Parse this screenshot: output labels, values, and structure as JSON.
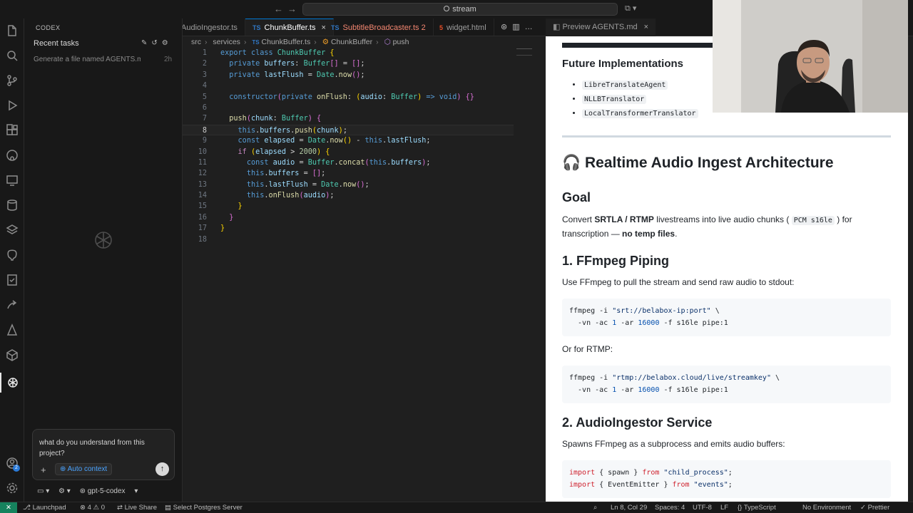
{
  "titlebar": {
    "search": "stream"
  },
  "sidebar": {
    "header": "CODEX",
    "recent_title": "Recent tasks",
    "task": "Generate a file named AGENTS.md t...",
    "task_time": "2h",
    "chat_placeholder": "what do you understand from this project?",
    "auto_context": "Auto context",
    "model": "gpt-5-codex"
  },
  "activity": {
    "badge": "2"
  },
  "editor": {
    "tabs": [
      {
        "label": "AudioIngestor.ts",
        "modified": ""
      },
      {
        "label": "ChunkBuffer.ts",
        "modified": ""
      },
      {
        "label": "SubtitleBroadcaster.ts",
        "modified": "2"
      },
      {
        "label": "widget.html",
        "modified": ""
      }
    ],
    "breadcrumb": [
      "src",
      "services",
      "ChunkBuffer.ts",
      "ChunkBuffer",
      "push"
    ],
    "line_numbers": [
      "1",
      "2",
      "3",
      "4",
      "5",
      "6",
      "7",
      "8",
      "9",
      "10",
      "11",
      "12",
      "13",
      "14",
      "15",
      "16",
      "17",
      "18"
    ],
    "current_line": "8"
  },
  "preview": {
    "tab": "Preview AGENTS.md",
    "future_title": "Future Implementations",
    "future_items": [
      "LibreTranslateAgent",
      "NLLBTranslator",
      "LocalTransformerTranslator"
    ],
    "main_title": "🎧 Realtime Audio Ingest Architecture",
    "goal_title": "Goal",
    "goal_text_1": "Convert",
    "goal_bold": "SRTLA / RTMP",
    "goal_text_2": "livestreams into live audio chunks (",
    "goal_code": "PCM s16le",
    "goal_text_3": ") for transcription —",
    "goal_bold_2": "no temp files",
    "s1_title": "1. FFmpeg Piping",
    "s1_text": "Use FFmpeg to pull the stream and send raw audio to stdout:",
    "or_rtmp": "Or for RTMP:",
    "s2_title": "2. AudioIngestor Service",
    "s2_text": "Spawns FFmpeg as a subprocess and emits audio buffers:"
  },
  "statusbar": {
    "launchpad": "Launchpad",
    "errors": "4",
    "warnings": "0",
    "live_share": "Live Share",
    "postgres": "Select Postgres Server",
    "cursor": "Ln 8, Col 29",
    "spaces": "Spaces: 4",
    "encoding": "UTF-8",
    "eol": "LF",
    "language": "TypeScript",
    "environment": "No Environment",
    "prettier": "Prettier"
  },
  "colors": {
    "accent": "#0078d4",
    "remote": "#16825d",
    "modified_tab": "#f48771"
  }
}
